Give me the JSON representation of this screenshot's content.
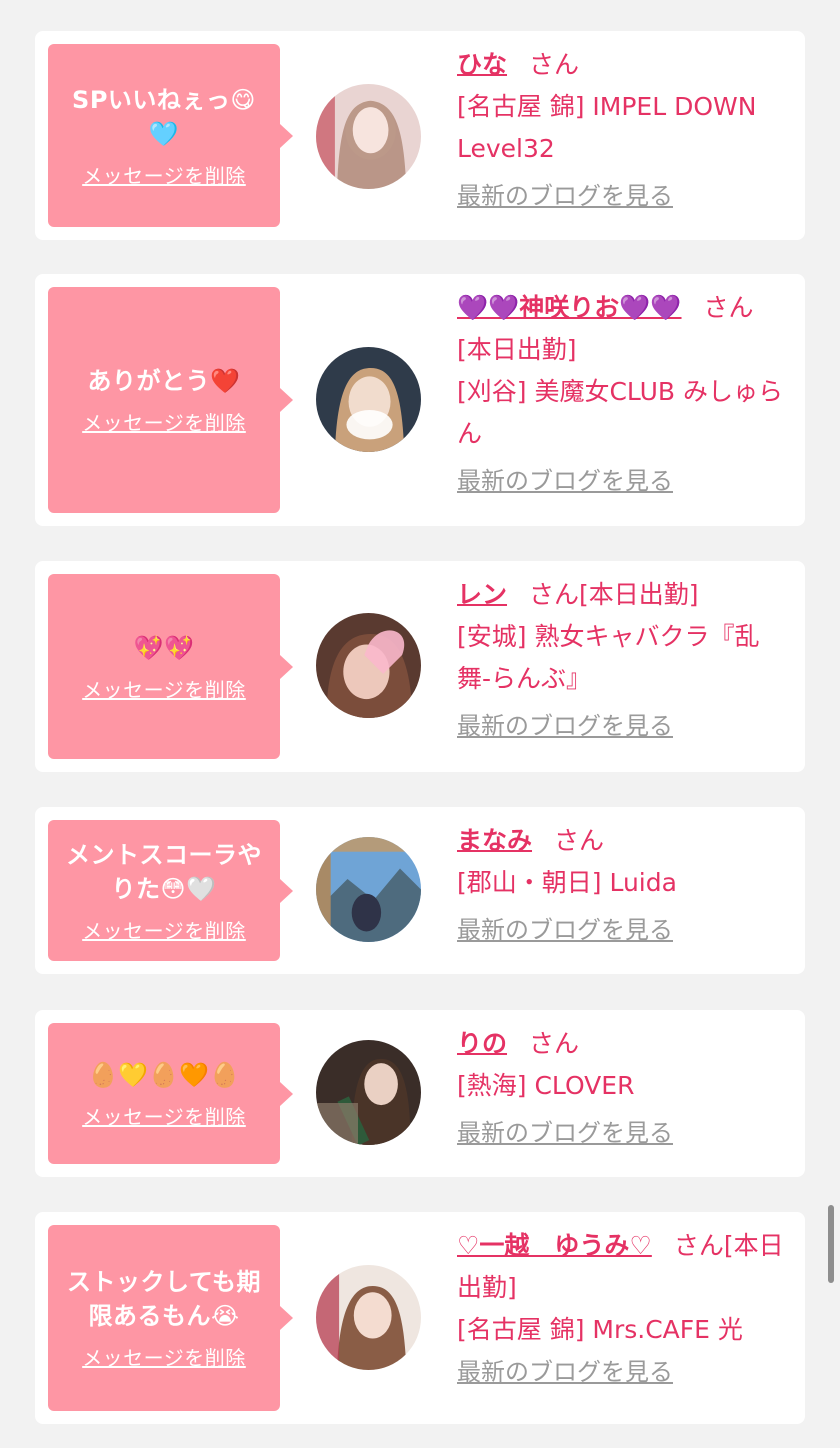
{
  "colors": {
    "accent": "#e53264",
    "bubble": "#fe96a4",
    "muted": "#9a9a9a",
    "background": "#f2f2f2"
  },
  "delete_label": "メッセージを削除",
  "san_label": "さん",
  "blog_label": "最新のブログを見る",
  "cards": [
    {
      "message": "SPいいねぇっ😋🩵",
      "name": "ひな",
      "lines": [
        "[名古屋 錦] IMPEL DOWN Level32"
      ],
      "avatar_icon": "avatar-photo-icon"
    },
    {
      "message": "ありがとう❤️",
      "name": "💜💜神咲りお💜💜",
      "lines": [
        "[本日出勤]",
        "[刈谷] 美魔女CLUB みしゅらん"
      ],
      "avatar_icon": "avatar-photo-icon"
    },
    {
      "message": "💖💖",
      "name": "レン",
      "inline_after": "[本日出勤]",
      "lines": [
        "[安城] 熟女キャバクラ『乱舞-らんぶ』"
      ],
      "avatar_icon": "avatar-photo-icon"
    },
    {
      "message": "メントスコーラやりた😳🤍",
      "name": "まなみ",
      "lines": [
        "[郡山・朝日] Luida"
      ],
      "avatar_icon": "avatar-photo-icon"
    },
    {
      "message": "🥚💛🥚🧡🥚",
      "name": "りの",
      "lines": [
        "[熱海] CLOVER"
      ],
      "avatar_icon": "avatar-photo-icon"
    },
    {
      "message": "ストックしても期限あるもん😭",
      "name": "♡一越　ゆうみ♡",
      "inline_after": "[本日出勤]",
      "lines": [
        "[名古屋 錦] Mrs.CAFE 光"
      ],
      "avatar_icon": "avatar-photo-icon"
    }
  ]
}
